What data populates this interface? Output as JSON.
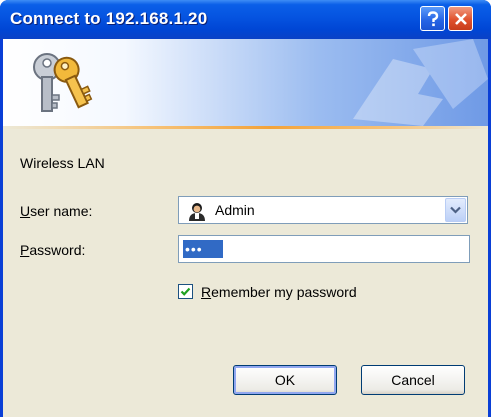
{
  "window": {
    "title": "Connect to 192.168.1.20"
  },
  "titlebar": {
    "help_icon": "question-mark",
    "close_icon": "x-mark"
  },
  "banner": {
    "icon": "keys-icon"
  },
  "form": {
    "realm": "Wireless LAN",
    "username_label_underlined": "U",
    "username_label_rest": "ser name:",
    "username_value": "Admin",
    "username_icon": "user-icon",
    "password_label_underlined": "P",
    "password_label_rest": "assword:",
    "password_value": "•••",
    "remember_checked": true,
    "remember_label_underlined": "R",
    "remember_label_rest": "emember my password"
  },
  "buttons": {
    "ok": "OK",
    "cancel": "Cancel"
  },
  "colors": {
    "titlebar": "#0a5fe8",
    "dialog_bg": "#ece9d8",
    "close_button": "#e0522e",
    "selection": "#316ac5"
  }
}
